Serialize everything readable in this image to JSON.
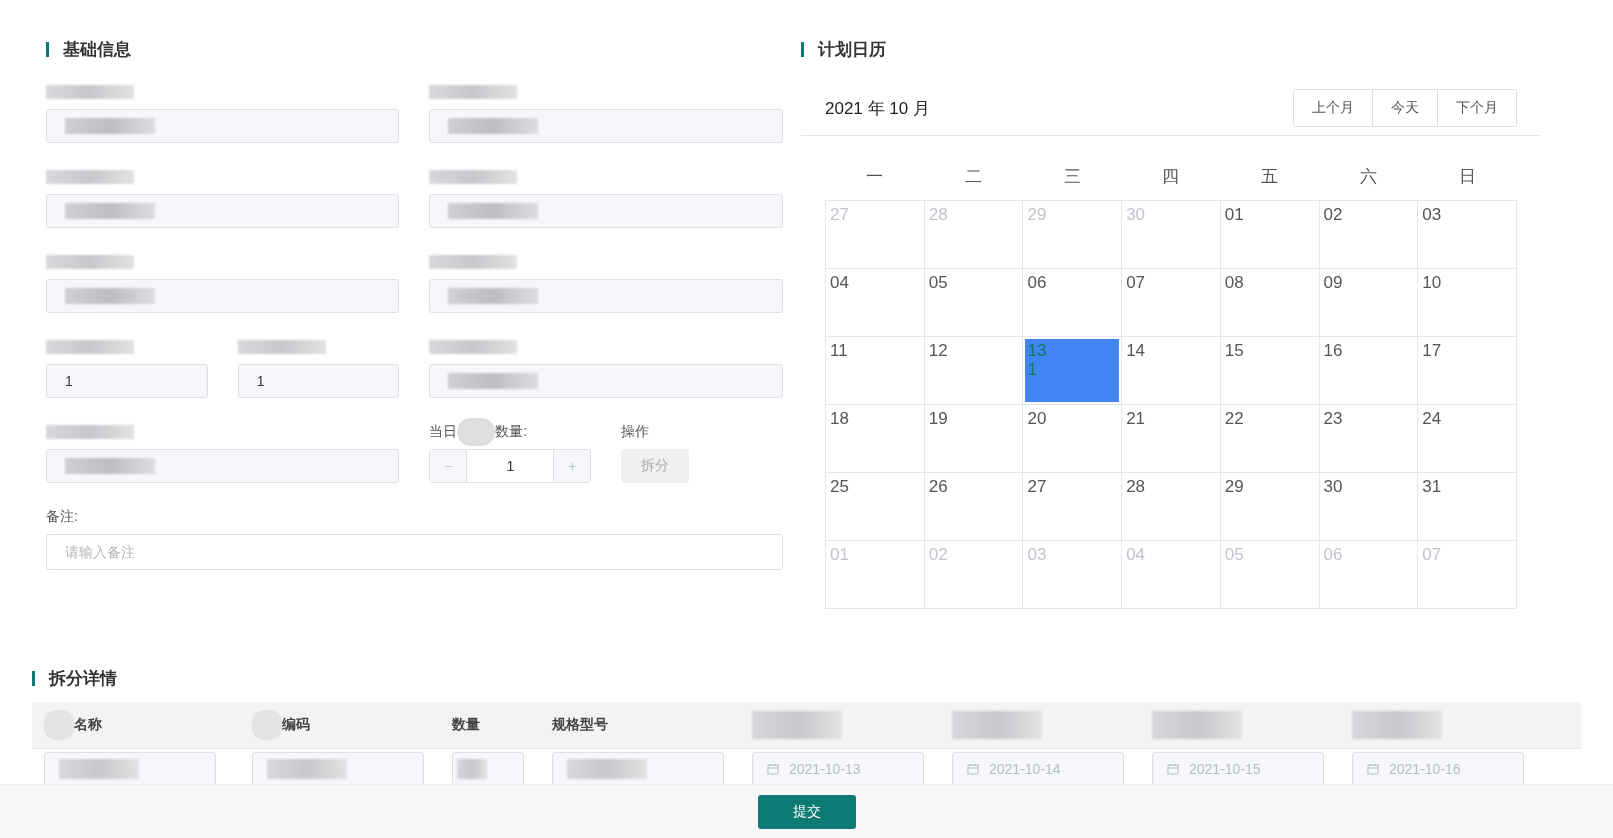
{
  "basic_info": {
    "title": "基础信息",
    "fields": [
      {
        "kind": "redacted"
      },
      {
        "kind": "redacted"
      },
      {
        "kind": "redacted"
      },
      {
        "kind": "redacted"
      },
      {
        "kind": "redacted"
      },
      {
        "kind": "redacted"
      },
      {
        "kind": "value",
        "value": "1"
      },
      {
        "kind": "value",
        "value": "1"
      },
      {
        "kind": "redacted"
      },
      {
        "kind": "redacted"
      },
      {
        "kind": "stepper",
        "label_start": "当日",
        "label_end": "数量:",
        "value": "1",
        "minus": "−",
        "plus": "+"
      },
      {
        "kind": "action",
        "label": "操作",
        "button": "拆分",
        "disabled": true
      }
    ],
    "remark": {
      "label": "备注:",
      "placeholder": "请输入备注"
    }
  },
  "calendar": {
    "title": "计划日历",
    "month": "2021 年 10 月",
    "buttons": [
      "上个月",
      "今天",
      "下个月"
    ],
    "weekdays": [
      "一",
      "二",
      "三",
      "四",
      "五",
      "六",
      "日"
    ],
    "days": [
      {
        "label": "27",
        "muted": true,
        "selected": false
      },
      {
        "label": "28",
        "muted": true,
        "selected": false
      },
      {
        "label": "29",
        "muted": true,
        "selected": false
      },
      {
        "label": "30",
        "muted": true,
        "selected": false
      },
      {
        "label": "01",
        "muted": false,
        "selected": false
      },
      {
        "label": "02",
        "muted": false,
        "selected": false
      },
      {
        "label": "03",
        "muted": false,
        "selected": false
      },
      {
        "label": "04",
        "muted": false,
        "selected": false
      },
      {
        "label": "05",
        "muted": false,
        "selected": false
      },
      {
        "label": "06",
        "muted": false,
        "selected": false
      },
      {
        "label": "07",
        "muted": false,
        "selected": false
      },
      {
        "label": "08",
        "muted": false,
        "selected": false
      },
      {
        "label": "09",
        "muted": false,
        "selected": false
      },
      {
        "label": "10",
        "muted": false,
        "selected": false
      },
      {
        "label": "11",
        "muted": false,
        "selected": false
      },
      {
        "label": "12",
        "muted": false,
        "selected": false
      },
      {
        "label": "13",
        "muted": false,
        "selected": true,
        "note": "1"
      },
      {
        "label": "14",
        "muted": false,
        "selected": false
      },
      {
        "label": "15",
        "muted": false,
        "selected": false
      },
      {
        "label": "16",
        "muted": false,
        "selected": false
      },
      {
        "label": "17",
        "muted": false,
        "selected": false
      },
      {
        "label": "18",
        "muted": false,
        "selected": false
      },
      {
        "label": "19",
        "muted": false,
        "selected": false
      },
      {
        "label": "20",
        "muted": false,
        "selected": false
      },
      {
        "label": "21",
        "muted": false,
        "selected": false
      },
      {
        "label": "22",
        "muted": false,
        "selected": false
      },
      {
        "label": "23",
        "muted": false,
        "selected": false
      },
      {
        "label": "24",
        "muted": false,
        "selected": false
      },
      {
        "label": "25",
        "muted": false,
        "selected": false
      },
      {
        "label": "26",
        "muted": false,
        "selected": false
      },
      {
        "label": "27",
        "muted": false,
        "selected": false
      },
      {
        "label": "28",
        "muted": false,
        "selected": false
      },
      {
        "label": "29",
        "muted": false,
        "selected": false
      },
      {
        "label": "30",
        "muted": false,
        "selected": false
      },
      {
        "label": "31",
        "muted": false,
        "selected": false
      },
      {
        "label": "01",
        "muted": true,
        "selected": false
      },
      {
        "label": "02",
        "muted": true,
        "selected": false
      },
      {
        "label": "03",
        "muted": true,
        "selected": false
      },
      {
        "label": "04",
        "muted": true,
        "selected": false
      },
      {
        "label": "05",
        "muted": true,
        "selected": false
      },
      {
        "label": "06",
        "muted": true,
        "selected": false
      },
      {
        "label": "07",
        "muted": true,
        "selected": false
      }
    ]
  },
  "split_details": {
    "title": "拆分详情",
    "columns": [
      {
        "kind": "partial",
        "label": "名称"
      },
      {
        "kind": "partial",
        "label": "编码"
      },
      {
        "kind": "text",
        "label": "数量"
      },
      {
        "kind": "text",
        "label": "规格型号"
      },
      {
        "kind": "redacted"
      },
      {
        "kind": "redacted"
      },
      {
        "kind": "redacted"
      },
      {
        "kind": "redacted"
      }
    ],
    "cells": [
      {
        "kind": "redacted"
      },
      {
        "kind": "redacted"
      },
      {
        "kind": "redacted_short"
      },
      {
        "kind": "redacted"
      },
      {
        "kind": "date",
        "value": "2021-10-13",
        "disabled": true
      },
      {
        "kind": "date",
        "value": "2021-10-14",
        "disabled": true
      },
      {
        "kind": "date",
        "value": "2021-10-15",
        "disabled": true
      },
      {
        "kind": "date",
        "value": "2021-10-16",
        "disabled": true
      }
    ]
  },
  "footer": {
    "submit": "提交"
  }
}
